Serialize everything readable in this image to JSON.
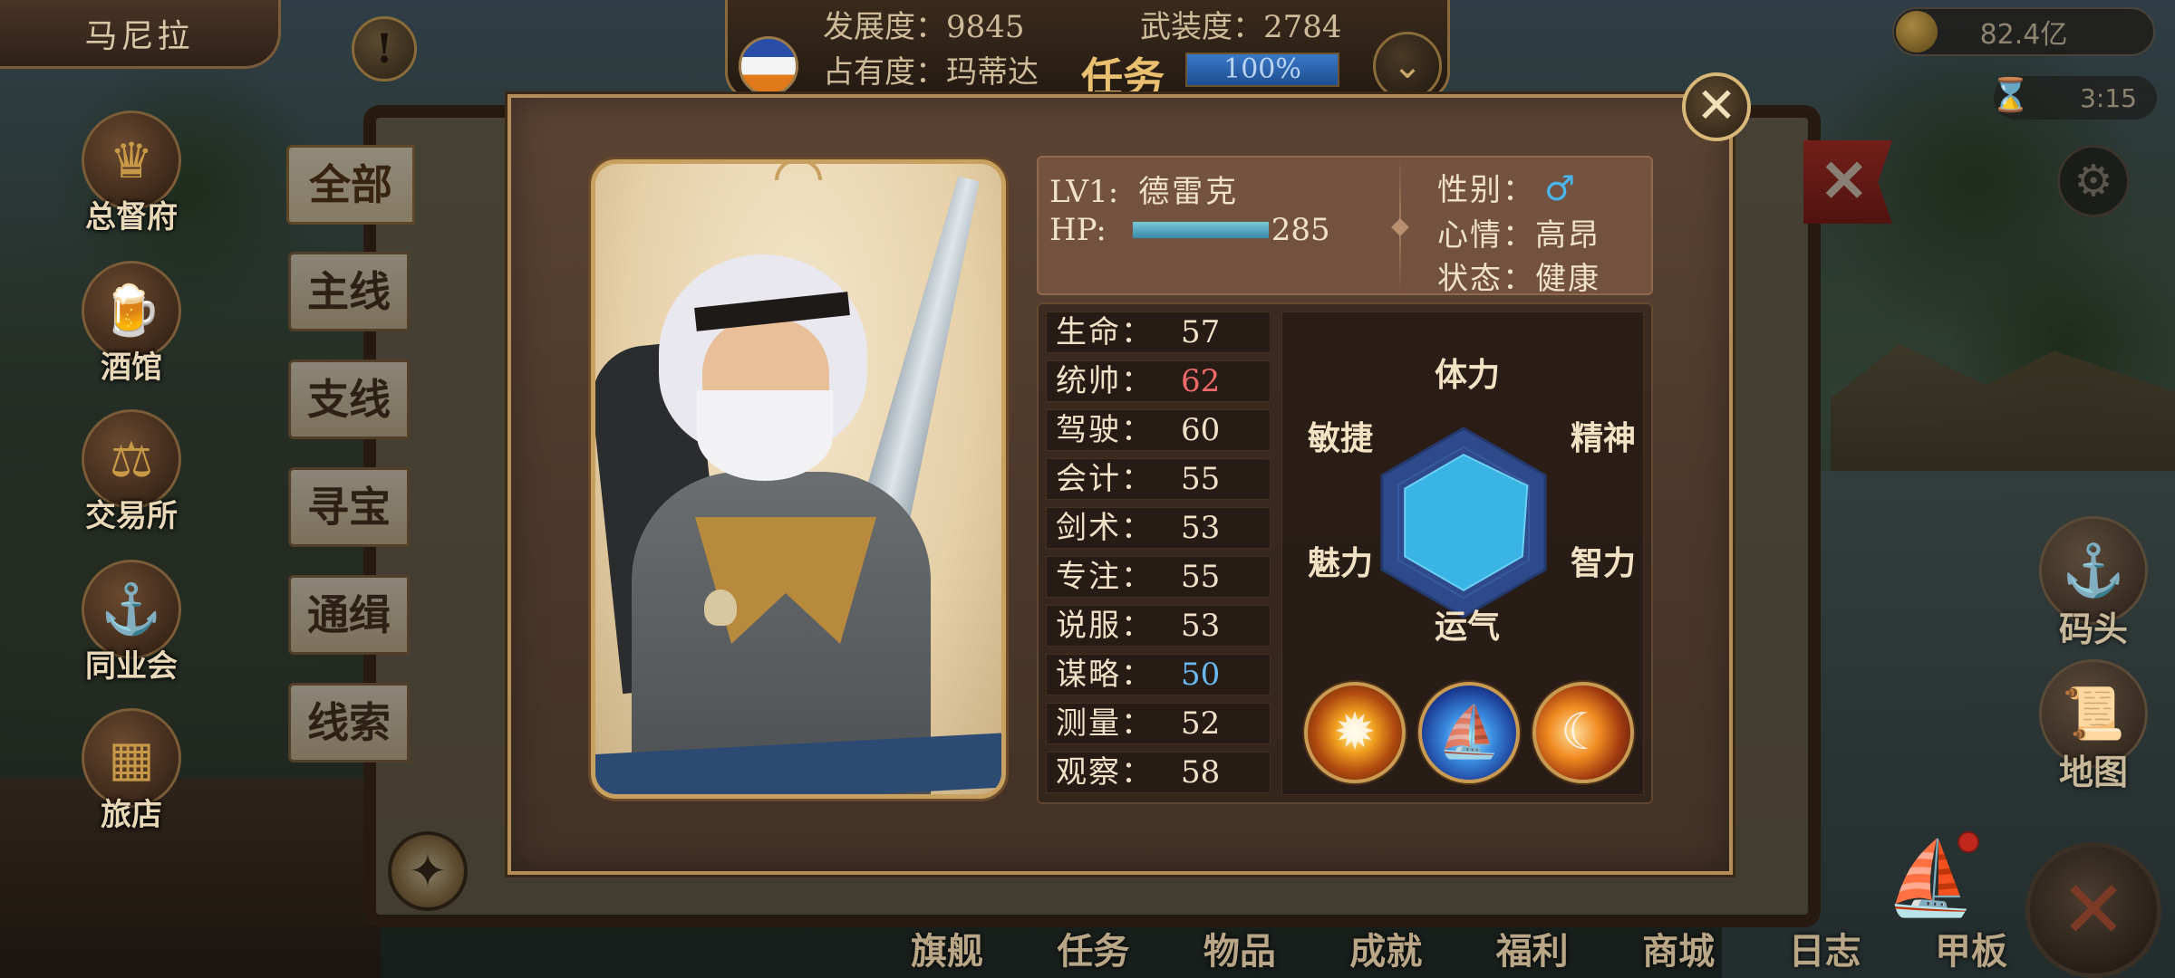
{
  "top": {
    "city": "马尼拉",
    "development": "发展度：9845",
    "armament": "武装度：2784",
    "occupancy": "占有度：玛蒂达",
    "task_label": "任务",
    "task_percent": "100%",
    "gold": "82.4亿",
    "time": "3:15"
  },
  "city_menu": [
    {
      "label": "总督府",
      "icon": "crown-icon"
    },
    {
      "label": "酒馆",
      "icon": "beer-mug-icon"
    },
    {
      "label": "交易所",
      "icon": "scales-icon"
    },
    {
      "label": "同业会",
      "icon": "anchor-shield-icon"
    },
    {
      "label": "旅店",
      "icon": "bag-icon"
    }
  ],
  "right_menu": [
    {
      "label": "码头",
      "icon": "dock-icon"
    },
    {
      "label": "地图",
      "icon": "map-scroll-icon"
    }
  ],
  "quest_tabs": [
    "全部",
    "主线",
    "支线",
    "寻宝",
    "通缉",
    "线索"
  ],
  "bottom_nav": [
    "旗舰",
    "任务",
    "物品",
    "成就",
    "福利",
    "商城",
    "日志",
    "甲板"
  ],
  "character": {
    "level": "LV1:",
    "name": "德雷克",
    "hp_label": "HP:",
    "hp_value": "285",
    "hp_fill": 1.0,
    "gender_label": "性别：",
    "gender_icon": "male-icon",
    "mood_label": "心情：",
    "mood_value": "高昂",
    "status_label": "状态：",
    "status_value": "健康"
  },
  "stats": [
    {
      "name": "生命：",
      "value": "57",
      "color": ""
    },
    {
      "name": "统帅：",
      "value": "62",
      "color": "red"
    },
    {
      "name": "驾驶：",
      "value": "60",
      "color": ""
    },
    {
      "name": "会计：",
      "value": "55",
      "color": ""
    },
    {
      "name": "剑术：",
      "value": "53",
      "color": ""
    },
    {
      "name": "专注：",
      "value": "55",
      "color": ""
    },
    {
      "name": "说服：",
      "value": "53",
      "color": ""
    },
    {
      "name": "谋略：",
      "value": "50",
      "color": "blue"
    },
    {
      "name": "测量：",
      "value": "52",
      "color": ""
    },
    {
      "name": "观察：",
      "value": "58",
      "color": ""
    }
  ],
  "radar": {
    "labels": [
      "体力",
      "精神",
      "智力",
      "运气",
      "魅力",
      "敏捷"
    ],
    "values": [
      0.72,
      0.78,
      0.72,
      0.72,
      0.72,
      0.72
    ],
    "fill_color": "#3ab4e4",
    "grid_color": "#2f4a8a"
  },
  "skills": [
    "sunburst-skill-icon",
    "ship-skill-icon",
    "horn-skill-icon"
  ],
  "colors": {
    "accent_gold": "#c8a060",
    "dialog_bg": "#4d392b",
    "stat_red": "#f06a6a",
    "stat_blue": "#6ab8f0"
  }
}
